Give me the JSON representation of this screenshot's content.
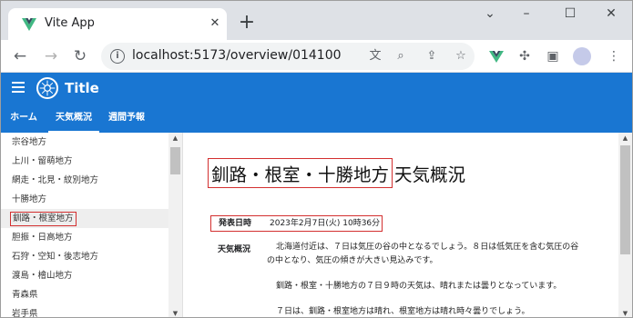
{
  "browser": {
    "tab_title": "Vite App",
    "url": "localhost:5173/overview/014100"
  },
  "app": {
    "title": "Title",
    "primary_color": "#1976d2"
  },
  "nav_tabs": [
    {
      "label": "ホーム",
      "active": false
    },
    {
      "label": "天気概況",
      "active": true
    },
    {
      "label": "週間予報",
      "active": false
    }
  ],
  "sidebar": {
    "items": [
      {
        "label": "宗谷地方"
      },
      {
        "label": "上川・留萌地方"
      },
      {
        "label": "網走・北見・紋別地方"
      },
      {
        "label": "十勝地方"
      },
      {
        "label": "釧路・根室地方"
      },
      {
        "label": "胆振・日高地方"
      },
      {
        "label": "石狩・空知・後志地方"
      },
      {
        "label": "渡島・檜山地方"
      },
      {
        "label": "青森県"
      },
      {
        "label": "岩手県"
      }
    ],
    "selected_index": 4
  },
  "main": {
    "region": "釧路・根室・十勝地方",
    "heading_suffix": "天気概況",
    "datetime_label": "発表日時",
    "datetime_value": "2023年2月7日(火) 10時36分",
    "overview_label": "天気概況",
    "paragraphs": [
      "北海道付近は、７日は気圧の谷の中となるでしょう。８日は低気圧を含む気圧の谷の中となり、気圧の傾きが大きい見込みです。",
      "釧路・根室・十勝地方の７日９時の天気は、晴れまたは曇りとなっています。",
      "７日は、釧路・根室地方は晴れ、根室地方は晴れ時々曇りでしょう。"
    ]
  }
}
